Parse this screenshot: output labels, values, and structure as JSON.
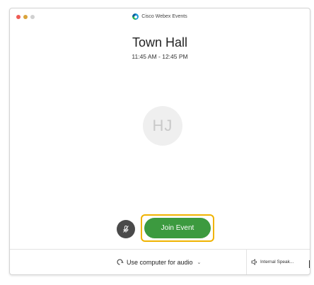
{
  "app": {
    "title": "Cisco Webex Events",
    "logo_icon": "webex-logo-icon"
  },
  "event": {
    "name": "Town Hall",
    "time": "11:45 AM - 12:45 PM"
  },
  "participant": {
    "initials": "HJ"
  },
  "controls": {
    "mute_icon": "microphone-muted-icon",
    "join_label": "Join Event",
    "join_color": "#3c9a3f",
    "highlight_color": "#f0b300"
  },
  "audio": {
    "connection_label": "Use computer for audio",
    "connection_icon": "audio-connect-icon",
    "speaker_label": "Internal Speak...",
    "speaker_icon": "speaker-icon"
  },
  "colors": {
    "close": "#ee5b55",
    "minimize": "#d9a33a",
    "zoom_disabled": "#d0d0d0"
  }
}
